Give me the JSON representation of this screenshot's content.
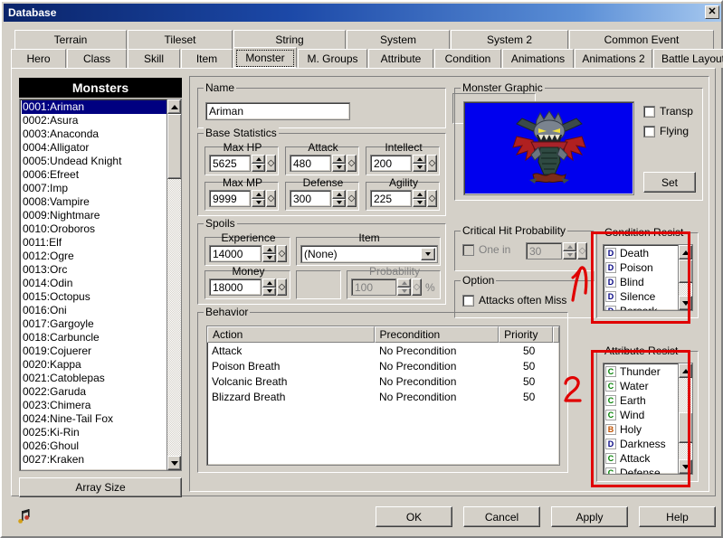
{
  "window": {
    "title": "Database",
    "close_label": "✕"
  },
  "tabs": {
    "row1": [
      "Terrain",
      "Tileset",
      "String",
      "System",
      "System 2",
      "Common Event"
    ],
    "row2": [
      "Hero",
      "Class",
      "Skill",
      "Item",
      "Monster",
      "M. Groups",
      "Attribute",
      "Condition",
      "Animations",
      "Animations 2",
      "Battle Layout"
    ],
    "selected": "Monster"
  },
  "list_panel": {
    "header": "Monsters",
    "array_size_label": "Array Size",
    "selected_index": 0,
    "items": [
      "0001:Ariman",
      "0002:Asura",
      "0003:Anaconda",
      "0004:Alligator",
      "0005:Undead Knight",
      "0006:Efreet",
      "0007:Imp",
      "0008:Vampire",
      "0009:Nightmare",
      "0010:Oroboros",
      "0011:Elf",
      "0012:Ogre",
      "0013:Orc",
      "0014:Odin",
      "0015:Octopus",
      "0016:Oni",
      "0017:Gargoyle",
      "0018:Carbuncle",
      "0019:Cojuerer",
      "0020:Kappa",
      "0021:Catoblepas",
      "0022:Garuda",
      "0023:Chimera",
      "0024:Nine-Tail Fox",
      "0025:Ki-Rin",
      "0026:Ghoul",
      "0027:Kraken"
    ]
  },
  "name_group": {
    "legend": "Name",
    "value": "Ariman",
    "placeholder": ""
  },
  "base_statistics": {
    "legend": "Base Statistics",
    "fields": [
      {
        "label": "Max HP",
        "value": "5625"
      },
      {
        "label": "Attack",
        "value": "480"
      },
      {
        "label": "Intellect",
        "value": "200"
      },
      {
        "label": "Max MP",
        "value": "9999"
      },
      {
        "label": "Defense",
        "value": "300"
      },
      {
        "label": "Agility",
        "value": "225"
      }
    ]
  },
  "spoils": {
    "legend": "Spoils",
    "experience": {
      "label": "Experience",
      "value": "14000"
    },
    "money": {
      "label": "Money",
      "value": "18000"
    },
    "item": {
      "label": "Item",
      "value": "(None)"
    },
    "probability": {
      "label": "Probability",
      "value": "100",
      "suffix": "%",
      "disabled": true
    }
  },
  "critical_hit": {
    "legend": "Critical Hit Probability",
    "checkbox_label": "One in",
    "checked": false,
    "value": "30",
    "disabled": true
  },
  "option": {
    "legend": "Option",
    "checkbox_label": "Attacks often Miss",
    "checked": false
  },
  "monster_graphic": {
    "legend": "Monster Graphic",
    "set_label": "Set",
    "background_color": "#0000ee",
    "transp": {
      "label": "Transp",
      "checked": false
    },
    "flying": {
      "label": "Flying",
      "checked": false
    }
  },
  "behavior": {
    "legend": "Behavior",
    "columns": [
      "Action",
      "Precondition",
      "Priority"
    ],
    "rows": [
      {
        "action": "Attack",
        "precondition": "No Precondition",
        "priority": "50"
      },
      {
        "action": "Poison Breath",
        "precondition": "No Precondition",
        "priority": "50"
      },
      {
        "action": "Volcanic Breath",
        "precondition": "No Precondition",
        "priority": "50"
      },
      {
        "action": "Blizzard Breath",
        "precondition": "No Precondition",
        "priority": "50"
      }
    ]
  },
  "condition_resist": {
    "legend": "Condition Resist",
    "items": [
      {
        "grade": "D",
        "label": "Death",
        "color": "#000080"
      },
      {
        "grade": "D",
        "label": "Poison",
        "color": "#000080"
      },
      {
        "grade": "D",
        "label": "Blind",
        "color": "#000080"
      },
      {
        "grade": "D",
        "label": "Silence",
        "color": "#000080"
      },
      {
        "grade": "D",
        "label": "Berserk",
        "color": "#000080"
      }
    ]
  },
  "attribute_resist": {
    "legend": "Attribute Resist",
    "items": [
      {
        "grade": "C",
        "label": "Thunder",
        "color": "#008000"
      },
      {
        "grade": "C",
        "label": "Water",
        "color": "#008000"
      },
      {
        "grade": "C",
        "label": "Earth",
        "color": "#008000"
      },
      {
        "grade": "C",
        "label": "Wind",
        "color": "#008000"
      },
      {
        "grade": "B",
        "label": "Holy",
        "color": "#c05000"
      },
      {
        "grade": "D",
        "label": "Darkness",
        "color": "#000080"
      },
      {
        "grade": "C",
        "label": "Attack",
        "color": "#008000"
      },
      {
        "grade": "C",
        "label": "Defense",
        "color": "#008000"
      }
    ]
  },
  "footer": {
    "ok": "OK",
    "cancel": "Cancel",
    "apply": "Apply",
    "help": "Help",
    "music_icon": "music-note-icon"
  },
  "annotations": [
    {
      "marker": "1",
      "target": "condition-resist"
    },
    {
      "marker": "2",
      "target": "attribute-resist"
    }
  ],
  "accent": {
    "highlight": "#000080",
    "annotation": "#e00000",
    "titlebar": "#0a246a"
  }
}
